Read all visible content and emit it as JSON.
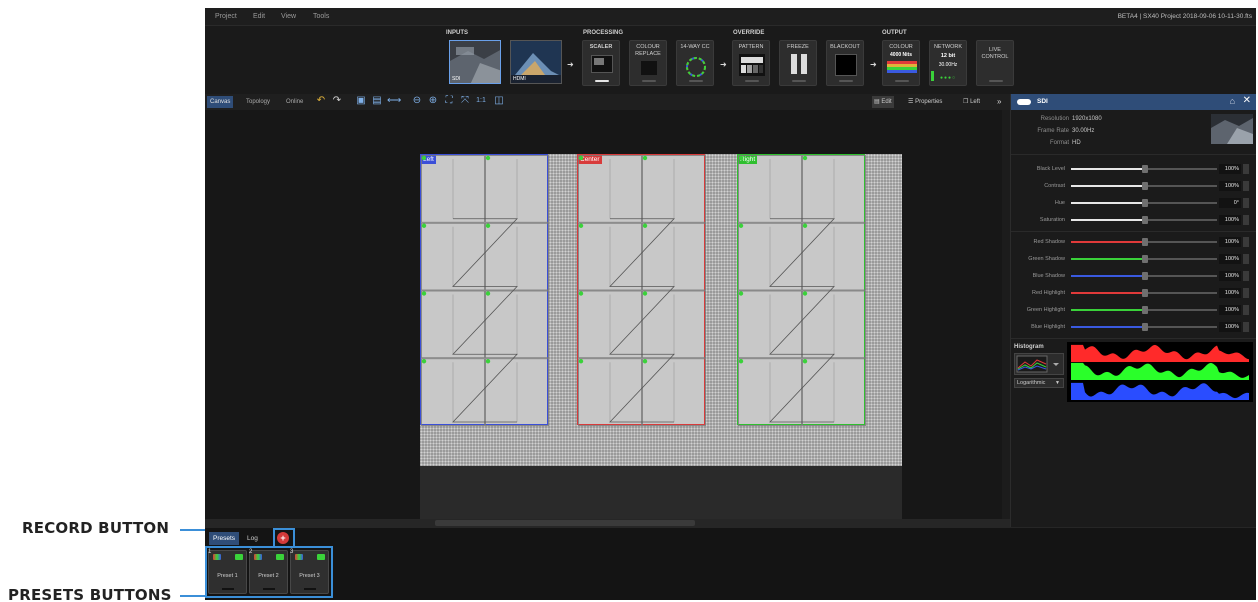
{
  "annotations": {
    "record_button": "RECORD BUTTON",
    "presets_buttons": "PRESETS BUTTONS"
  },
  "menubar": {
    "items": [
      "Project",
      "Edit",
      "View",
      "Tools"
    ],
    "project_title": "BETA4 | SX40 Project 2018-09-06 10-11-30.fts"
  },
  "pipeline": {
    "sections": {
      "inputs": "INPUTS",
      "processing": "PROCESSING",
      "override": "OVERRIDE",
      "output": "OUTPUT"
    },
    "inputs": [
      {
        "label": "SDI",
        "selected": true
      },
      {
        "label": "HDMI",
        "selected": false
      }
    ],
    "processing": [
      {
        "label": "SCALER",
        "selected": false
      },
      {
        "label": "COLOUR REPLACE",
        "selected": false
      },
      {
        "label": "14-WAY CC",
        "selected": false
      }
    ],
    "override": [
      {
        "label": "PATTERN"
      },
      {
        "label": "FREEZE"
      },
      {
        "label": "BLACKOUT"
      }
    ],
    "output": [
      {
        "label": "COLOUR",
        "sub": "4000 Nits"
      },
      {
        "label": "NETWORK",
        "sub": "12 bit",
        "sub2": "30.00Hz"
      },
      {
        "label": "LIVE CONTROL"
      }
    ]
  },
  "toolbar": {
    "tabs": [
      "Canvas",
      "Topology",
      "Online"
    ],
    "active_tab": "Canvas",
    "edit_label": "Edit",
    "properties_label": "Properties",
    "left_label": "Left"
  },
  "canvas": {
    "panels": [
      {
        "label": "Left",
        "color": "#3b4fd8"
      },
      {
        "label": "Center",
        "color": "#d83b3b"
      },
      {
        "label": "Right",
        "color": "#2fbf2f"
      }
    ]
  },
  "properties": {
    "title": "SDI",
    "resolution_key": "Resolution",
    "resolution": "1920x1080",
    "frame_rate_key": "Frame Rate",
    "frame_rate": "30.00Hz",
    "format_key": "Format",
    "format": "HD",
    "sliders": [
      {
        "label": "Black Level",
        "value": "100%",
        "color": "#e6e6e6"
      },
      {
        "label": "Contrast",
        "value": "100%",
        "color": "#e6e6e6"
      },
      {
        "label": "Hue",
        "value": "0°",
        "color": "#e6e6e6"
      },
      {
        "label": "Saturation",
        "value": "100%",
        "color": "#e6e6e6"
      },
      {
        "label": "Red Shadow",
        "value": "100%",
        "color": "#e03a3a"
      },
      {
        "label": "Green Shadow",
        "value": "100%",
        "color": "#3ad23a"
      },
      {
        "label": "Blue Shadow",
        "value": "100%",
        "color": "#3a5ae0"
      },
      {
        "label": "Red Highlight",
        "value": "100%",
        "color": "#e03a3a"
      },
      {
        "label": "Green Highlight",
        "value": "100%",
        "color": "#3ad23a"
      },
      {
        "label": "Blue Highlight",
        "value": "100%",
        "color": "#3a5ae0"
      }
    ],
    "histogram_label": "Histogram",
    "scale_select": "Logarithmic"
  },
  "dock": {
    "tabs": [
      "Presets",
      "Log"
    ],
    "active_tab": "Presets",
    "record_symbol": "+",
    "presets": [
      {
        "num": "1",
        "name": "Preset 1"
      },
      {
        "num": "2",
        "name": "Preset 2"
      },
      {
        "num": "3",
        "name": "Preset 3"
      }
    ]
  }
}
